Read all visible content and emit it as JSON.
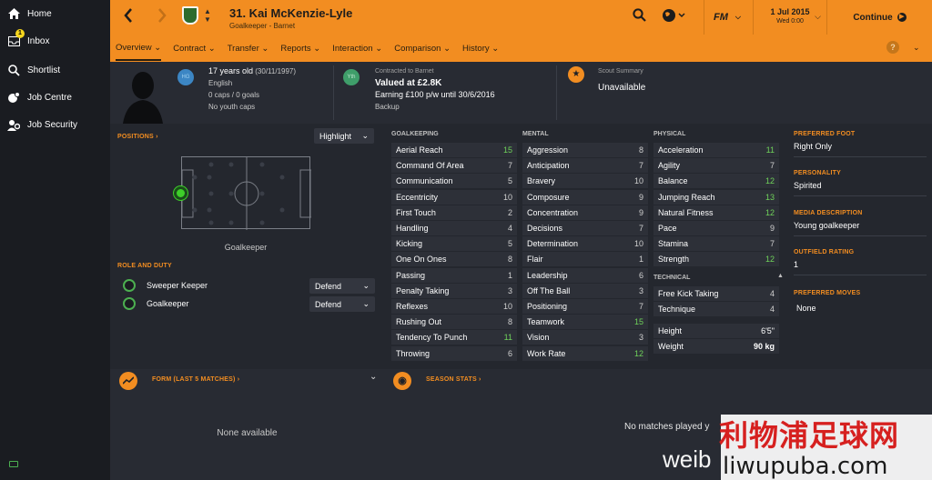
{
  "sidebar": {
    "items": [
      {
        "label": "Home",
        "icon": "home-icon"
      },
      {
        "label": "Inbox",
        "icon": "inbox-icon",
        "badge": "1"
      },
      {
        "label": "Shortlist",
        "icon": "search-icon"
      },
      {
        "label": "Job Centre",
        "icon": "globe-pin-icon"
      },
      {
        "label": "Job Security",
        "icon": "person-gear-icon"
      }
    ]
  },
  "header": {
    "player_name": "31. Kai McKenzie-Lyle",
    "player_subtitle": "Goalkeeper - Barnet",
    "fm_label": "FM",
    "date": "1 Jul 2015",
    "day_time": "Wed 0:00",
    "continue_label": "Continue",
    "tabs": [
      "Overview",
      "Contract",
      "Transfer",
      "Reports",
      "Interaction",
      "Comparison",
      "History"
    ],
    "help_label": "?"
  },
  "info": {
    "hg_badge": "HG",
    "age": "17 years old",
    "dob": "(30/11/1997)",
    "nationality": "English",
    "caps": "0 caps / 0 goals",
    "youth_caps": "No youth caps",
    "yth_badge": "Yth",
    "contract_label": "Contracted to Barnet",
    "value": "Valued at £2.8K",
    "earning": "Earning £100 p/w until 30/6/2016",
    "squad_status": "Backup",
    "scout_label": "Scout Summary",
    "scout_value": "Unavailable"
  },
  "positions": {
    "label": "POSITIONS",
    "highlight": "Highlight",
    "position_name": "Goalkeeper",
    "role_label": "ROLE AND DUTY",
    "roles": [
      {
        "role": "Sweeper Keeper",
        "duty": "Defend"
      },
      {
        "role": "Goalkeeper",
        "duty": "Defend"
      }
    ]
  },
  "attributes": {
    "goalkeeping_label": "GOALKEEPING",
    "mental_label": "MENTAL",
    "physical_label": "PHYSICAL",
    "technical_label": "TECHNICAL",
    "goalkeeping": [
      {
        "name": "Aerial Reach",
        "value": "15",
        "hi": true
      },
      {
        "name": "Command Of Area",
        "value": "7"
      },
      {
        "name": "Communication",
        "value": "5"
      },
      {
        "name": "Eccentricity",
        "value": "10"
      },
      {
        "name": "First Touch",
        "value": "2"
      },
      {
        "name": "Handling",
        "value": "4"
      },
      {
        "name": "Kicking",
        "value": "5"
      },
      {
        "name": "One On Ones",
        "value": "8"
      },
      {
        "name": "Passing",
        "value": "1"
      },
      {
        "name": "Penalty Taking",
        "value": "3"
      },
      {
        "name": "Reflexes",
        "value": "10"
      },
      {
        "name": "Rushing Out",
        "value": "8"
      },
      {
        "name": "Tendency To Punch",
        "value": "11",
        "hi": true
      },
      {
        "name": "Throwing",
        "value": "6"
      }
    ],
    "mental": [
      {
        "name": "Aggression",
        "value": "8"
      },
      {
        "name": "Anticipation",
        "value": "7"
      },
      {
        "name": "Bravery",
        "value": "10"
      },
      {
        "name": "Composure",
        "value": "9"
      },
      {
        "name": "Concentration",
        "value": "9"
      },
      {
        "name": "Decisions",
        "value": "7"
      },
      {
        "name": "Determination",
        "value": "10"
      },
      {
        "name": "Flair",
        "value": "1"
      },
      {
        "name": "Leadership",
        "value": "6"
      },
      {
        "name": "Off The Ball",
        "value": "3"
      },
      {
        "name": "Positioning",
        "value": "7"
      },
      {
        "name": "Teamwork",
        "value": "15",
        "hi": true
      },
      {
        "name": "Vision",
        "value": "3"
      },
      {
        "name": "Work Rate",
        "value": "12",
        "hi": true
      }
    ],
    "physical": [
      {
        "name": "Acceleration",
        "value": "11",
        "hi": true
      },
      {
        "name": "Agility",
        "value": "7"
      },
      {
        "name": "Balance",
        "value": "12",
        "hi": true
      },
      {
        "name": "Jumping Reach",
        "value": "13",
        "hi": true
      },
      {
        "name": "Natural Fitness",
        "value": "12",
        "hi": true
      },
      {
        "name": "Pace",
        "value": "9"
      },
      {
        "name": "Stamina",
        "value": "7"
      },
      {
        "name": "Strength",
        "value": "12",
        "hi": true
      }
    ],
    "technical": [
      {
        "name": "Free Kick Taking",
        "value": "4"
      },
      {
        "name": "Technique",
        "value": "4"
      }
    ],
    "height_label": "Height",
    "height": "6'5\"",
    "weight_label": "Weight",
    "weight": "90 kg"
  },
  "right_col": {
    "preferred_foot_label": "PREFERRED FOOT",
    "preferred_foot": "Right Only",
    "personality_label": "PERSONALITY",
    "personality": "Spirited",
    "media_label": "MEDIA DESCRIPTION",
    "media": "Young goalkeeper",
    "outfield_label": "OUTFIELD RATING",
    "outfield": "1",
    "moves_label": "PREFERRED MOVES",
    "moves": "None"
  },
  "bottom": {
    "form_label": "FORM (LAST 5 MATCHES)",
    "form_empty": "None available",
    "season_label": "SEASON STATS",
    "season_empty": "No matches played y"
  },
  "watermark": {
    "weibo": "weib",
    "cn_text": "利物浦足球网",
    "url": "liwupuba.com"
  },
  "colors": {
    "accent": "#f28d21",
    "highlight_green": "#6fd25a",
    "panel": "#282b33",
    "sidebar": "#1a1c21"
  }
}
